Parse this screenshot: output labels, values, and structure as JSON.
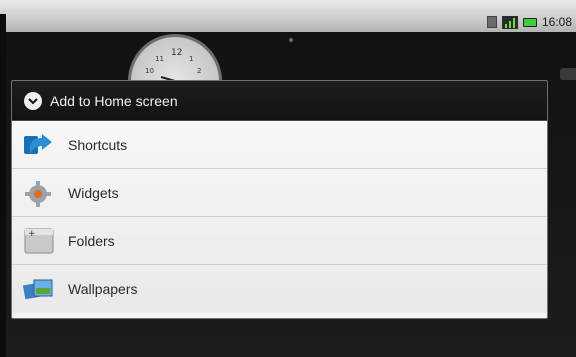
{
  "status_bar": {
    "time": "16:08",
    "icons": [
      "sd-card-icon",
      "signal-icon",
      "battery-icon"
    ],
    "battery_color": "#3cd13c"
  },
  "home": {
    "widget": "analog-clock"
  },
  "dialog": {
    "title": "Add to Home screen",
    "title_icon": "chevron-down-circle-icon",
    "items": [
      {
        "label": "Shortcuts",
        "icon": "shortcut-arrow-icon"
      },
      {
        "label": "Widgets",
        "icon": "widgets-gear-icon"
      },
      {
        "label": "Folders",
        "icon": "folder-icon"
      },
      {
        "label": "Wallpapers",
        "icon": "wallpaper-pictures-icon"
      }
    ]
  },
  "colors": {
    "dialog_header": "#121212",
    "dialog_body": "#f4f4f4",
    "clock_text": "#1a1a1a"
  }
}
